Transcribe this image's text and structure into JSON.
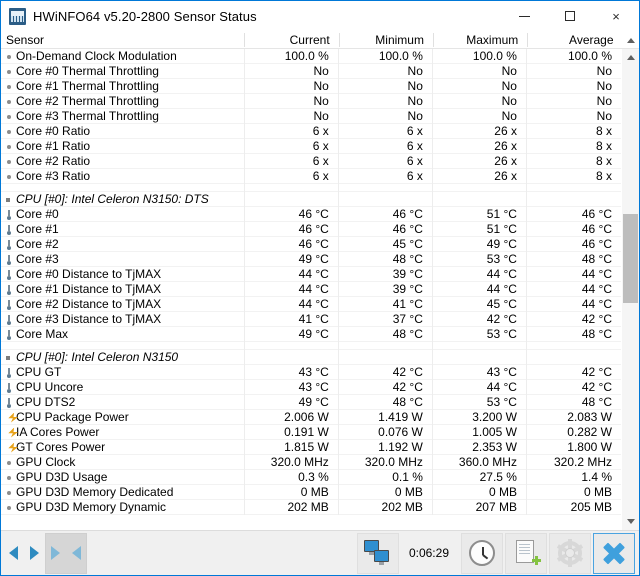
{
  "window": {
    "title": "HWiNFO64 v5.20-2800 Sensor Status",
    "app_icon": "hwinfo-icon",
    "minimize_label": "",
    "maximize_label": "",
    "close_label": "×",
    "accent_color": "#0078d7"
  },
  "table": {
    "columns": [
      "Sensor",
      "Current",
      "Minimum",
      "Maximum",
      "Average"
    ],
    "rows": [
      {
        "type": "data",
        "icon": "dot",
        "label": "On-Demand Clock Modulation",
        "current": "100.0 %",
        "minimum": "100.0 %",
        "maximum": "100.0 %",
        "average": "100.0 %"
      },
      {
        "type": "data",
        "icon": "dot",
        "label": "Core #0 Thermal Throttling",
        "current": "No",
        "minimum": "No",
        "maximum": "No",
        "average": "No"
      },
      {
        "type": "data",
        "icon": "dot",
        "label": "Core #1 Thermal Throttling",
        "current": "No",
        "minimum": "No",
        "maximum": "No",
        "average": "No"
      },
      {
        "type": "data",
        "icon": "dot",
        "label": "Core #2 Thermal Throttling",
        "current": "No",
        "minimum": "No",
        "maximum": "No",
        "average": "No"
      },
      {
        "type": "data",
        "icon": "dot",
        "label": "Core #3 Thermal Throttling",
        "current": "No",
        "minimum": "No",
        "maximum": "No",
        "average": "No"
      },
      {
        "type": "data",
        "icon": "dot",
        "label": "Core #0 Ratio",
        "current": "6 x",
        "minimum": "6 x",
        "maximum": "26 x",
        "average": "8 x"
      },
      {
        "type": "data",
        "icon": "dot",
        "label": "Core #1 Ratio",
        "current": "6 x",
        "minimum": "6 x",
        "maximum": "26 x",
        "average": "8 x"
      },
      {
        "type": "data",
        "icon": "dot",
        "label": "Core #2 Ratio",
        "current": "6 x",
        "minimum": "6 x",
        "maximum": "26 x",
        "average": "8 x"
      },
      {
        "type": "data",
        "icon": "dot",
        "label": "Core #3 Ratio",
        "current": "6 x",
        "minimum": "6 x",
        "maximum": "26 x",
        "average": "8 x"
      },
      {
        "type": "gap",
        "icon": "",
        "label": "",
        "current": "",
        "minimum": "",
        "maximum": "",
        "average": ""
      },
      {
        "type": "section",
        "icon": "sec",
        "label": "CPU [#0]: Intel Celeron N3150: DTS",
        "current": "",
        "minimum": "",
        "maximum": "",
        "average": ""
      },
      {
        "type": "data",
        "icon": "temp",
        "label": "Core #0",
        "current": "46 °C",
        "minimum": "46 °C",
        "maximum": "51 °C",
        "average": "46 °C"
      },
      {
        "type": "data",
        "icon": "temp",
        "label": "Core #1",
        "current": "46 °C",
        "minimum": "46 °C",
        "maximum": "51 °C",
        "average": "46 °C"
      },
      {
        "type": "data",
        "icon": "temp",
        "label": "Core #2",
        "current": "46 °C",
        "minimum": "45 °C",
        "maximum": "49 °C",
        "average": "46 °C"
      },
      {
        "type": "data",
        "icon": "temp",
        "label": "Core #3",
        "current": "49 °C",
        "minimum": "48 °C",
        "maximum": "53 °C",
        "average": "48 °C"
      },
      {
        "type": "data",
        "icon": "temp",
        "label": "Core #0 Distance to TjMAX",
        "current": "44 °C",
        "minimum": "39 °C",
        "maximum": "44 °C",
        "average": "44 °C"
      },
      {
        "type": "data",
        "icon": "temp",
        "label": "Core #1 Distance to TjMAX",
        "current": "44 °C",
        "minimum": "39 °C",
        "maximum": "44 °C",
        "average": "44 °C"
      },
      {
        "type": "data",
        "icon": "temp",
        "label": "Core #2 Distance to TjMAX",
        "current": "44 °C",
        "minimum": "41 °C",
        "maximum": "45 °C",
        "average": "44 °C"
      },
      {
        "type": "data",
        "icon": "temp",
        "label": "Core #3 Distance to TjMAX",
        "current": "41 °C",
        "minimum": "37 °C",
        "maximum": "42 °C",
        "average": "42 °C"
      },
      {
        "type": "data",
        "icon": "temp",
        "label": "Core Max",
        "current": "49 °C",
        "minimum": "48 °C",
        "maximum": "53 °C",
        "average": "48 °C"
      },
      {
        "type": "gap",
        "icon": "",
        "label": "",
        "current": "",
        "minimum": "",
        "maximum": "",
        "average": ""
      },
      {
        "type": "section",
        "icon": "sec",
        "label": "CPU [#0]: Intel Celeron N3150",
        "current": "",
        "minimum": "",
        "maximum": "",
        "average": ""
      },
      {
        "type": "data",
        "icon": "temp",
        "label": "CPU GT",
        "current": "43 °C",
        "minimum": "42 °C",
        "maximum": "43 °C",
        "average": "42 °C"
      },
      {
        "type": "data",
        "icon": "temp",
        "label": "CPU Uncore",
        "current": "43 °C",
        "minimum": "42 °C",
        "maximum": "44 °C",
        "average": "42 °C"
      },
      {
        "type": "data",
        "icon": "temp",
        "label": "CPU DTS2",
        "current": "49 °C",
        "minimum": "48 °C",
        "maximum": "53 °C",
        "average": "48 °C"
      },
      {
        "type": "data",
        "icon": "power",
        "label": "CPU Package Power",
        "current": "2.006 W",
        "minimum": "1.419 W",
        "maximum": "3.200 W",
        "average": "2.083 W"
      },
      {
        "type": "data",
        "icon": "power",
        "label": "IA Cores Power",
        "current": "0.191 W",
        "minimum": "0.076 W",
        "maximum": "1.005 W",
        "average": "0.282 W"
      },
      {
        "type": "data",
        "icon": "power",
        "label": "GT Cores Power",
        "current": "1.815 W",
        "minimum": "1.192 W",
        "maximum": "2.353 W",
        "average": "1.800 W"
      },
      {
        "type": "data",
        "icon": "dot",
        "label": "GPU Clock",
        "current": "320.0 MHz",
        "minimum": "320.0 MHz",
        "maximum": "360.0 MHz",
        "average": "320.2 MHz"
      },
      {
        "type": "data",
        "icon": "dot",
        "label": "GPU D3D Usage",
        "current": "0.3 %",
        "minimum": "0.1 %",
        "maximum": "27.5 %",
        "average": "1.4 %"
      },
      {
        "type": "data",
        "icon": "dot",
        "label": "GPU D3D Memory Dedicated",
        "current": "0 MB",
        "minimum": "0 MB",
        "maximum": "0 MB",
        "average": "0 MB"
      },
      {
        "type": "data",
        "icon": "dot",
        "label": "GPU D3D Memory Dynamic",
        "current": "202 MB",
        "minimum": "202 MB",
        "maximum": "207 MB",
        "average": "205 MB"
      }
    ]
  },
  "scrollbar": {
    "up_arrow": "scroll-up",
    "down_arrow": "scroll-down"
  },
  "toolbar": {
    "expand_label": "",
    "collapse_label": "",
    "monitor_label": "",
    "timer": "0:06:29",
    "clock_label": "",
    "report_label": "",
    "settings_label": "",
    "close_label": ""
  }
}
